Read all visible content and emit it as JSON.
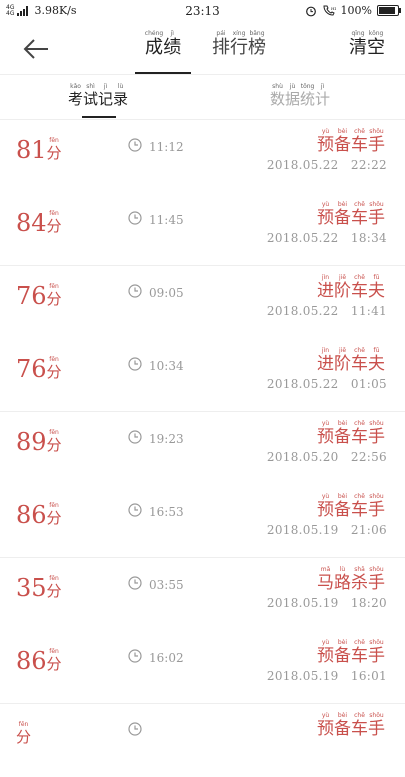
{
  "status": {
    "signal1": "4G",
    "signal2": "4G",
    "speed": "3.98K/s",
    "time": "23:13",
    "battery": "100%"
  },
  "header": {
    "tabs": [
      {
        "label": "成绩",
        "pinyin": [
          "chéng",
          "jì"
        ]
      },
      {
        "label": "排行榜",
        "pinyin": [
          "pái",
          "xíng",
          "bǎng"
        ]
      }
    ],
    "clear": {
      "label": "清空",
      "pinyin": [
        "qīng",
        "kōng"
      ]
    }
  },
  "subtabs": [
    {
      "label": "考试记录",
      "pinyin": [
        "kǎo",
        "shì",
        "jì",
        "lù"
      ]
    },
    {
      "label": "数据统计",
      "pinyin": [
        "shù",
        "jù",
        "tǒng",
        "jì"
      ]
    }
  ],
  "unit": {
    "label": "分",
    "pinyin": "fēn"
  },
  "records": [
    {
      "score": "81",
      "duration": "11:12",
      "level": "预备车手",
      "level_pinyin": [
        "yù",
        "bèi",
        "chē",
        "shǒu"
      ],
      "date": "2018.05.22",
      "clock": "22:22"
    },
    {
      "score": "84",
      "duration": "11:45",
      "level": "预备车手",
      "level_pinyin": [
        "yù",
        "bèi",
        "chē",
        "shǒu"
      ],
      "date": "2018.05.22",
      "clock": "18:34"
    },
    {
      "score": "76",
      "duration": "09:05",
      "level": "进阶车夫",
      "level_pinyin": [
        "jìn",
        "jiē",
        "chē",
        "fū"
      ],
      "date": "2018.05.22",
      "clock": "11:41"
    },
    {
      "score": "76",
      "duration": "10:34",
      "level": "进阶车夫",
      "level_pinyin": [
        "jìn",
        "jiē",
        "chē",
        "fū"
      ],
      "date": "2018.05.22",
      "clock": "01:05"
    },
    {
      "score": "89",
      "duration": "19:23",
      "level": "预备车手",
      "level_pinyin": [
        "yù",
        "bèi",
        "chē",
        "shǒu"
      ],
      "date": "2018.05.20",
      "clock": "22:56"
    },
    {
      "score": "86",
      "duration": "16:53",
      "level": "预备车手",
      "level_pinyin": [
        "yù",
        "bèi",
        "chē",
        "shǒu"
      ],
      "date": "2018.05.19",
      "clock": "21:06"
    },
    {
      "score": "35",
      "duration": "03:55",
      "level": "马路杀手",
      "level_pinyin": [
        "mǎ",
        "lù",
        "shā",
        "shǒu"
      ],
      "date": "2018.05.19",
      "clock": "18:20"
    },
    {
      "score": "86",
      "duration": "16:02",
      "level": "预备车手",
      "level_pinyin": [
        "yù",
        "bèi",
        "chē",
        "shǒu"
      ],
      "date": "2018.05.19",
      "clock": "16:01"
    },
    {
      "score": "",
      "duration": "",
      "level": "预备车手",
      "level_pinyin": [
        "yù",
        "bèi",
        "chē",
        "shǒu"
      ],
      "date": "",
      "clock": ""
    }
  ],
  "colors": {
    "accent": "#c9504c",
    "muted": "#999999"
  }
}
